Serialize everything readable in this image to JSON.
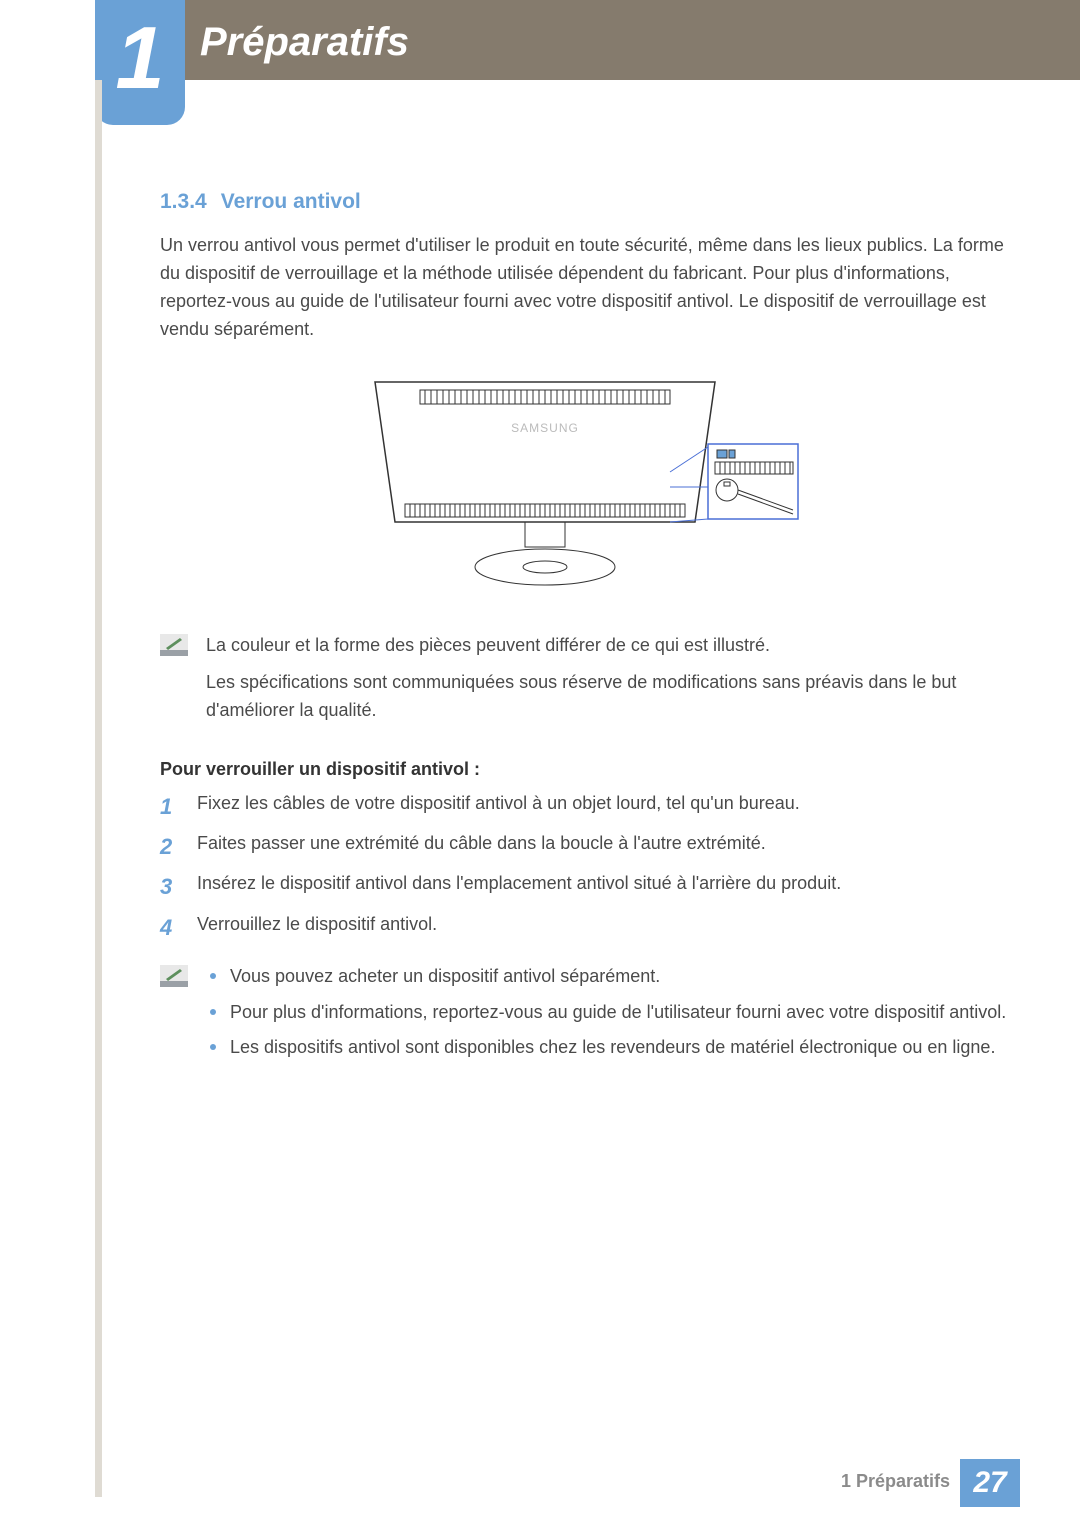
{
  "chapter": {
    "number": "1",
    "title": "Préparatifs"
  },
  "section": {
    "number": "1.3.4",
    "title": "Verrou antivol"
  },
  "intro_paragraph": "Un verrou antivol vous permet d'utiliser le produit en toute sécurité, même dans les lieux publics. La forme du dispositif de verrouillage et la méthode utilisée dépendent du fabricant. Pour plus d'informations, reportez-vous au guide de l'utilisateur fourni avec votre dispositif antivol. Le dispositif de verrouillage est vendu séparément.",
  "figure_brand_text": "SAMSUNG",
  "note1": {
    "line1": "La couleur et la forme des pièces peuvent différer de ce qui est illustré.",
    "line2": "Les spécifications sont communiquées sous réserve de modifications sans préavis dans le but d'améliorer la qualité."
  },
  "procedure": {
    "heading": "Pour verrouiller un dispositif antivol :",
    "steps": [
      "Fixez les câbles de votre dispositif antivol à un objet lourd, tel qu'un bureau.",
      "Faites passer une extrémité du câble dans la boucle à l'autre extrémité.",
      "Insérez le dispositif antivol dans l'emplacement antivol situé à l'arrière du produit.",
      "Verrouillez le dispositif antivol."
    ]
  },
  "note2": {
    "bullets": [
      "Vous pouvez acheter un dispositif antivol séparément.",
      "Pour plus d'informations, reportez-vous au guide de l'utilisateur fourni avec votre dispositif antivol.",
      "Les dispositifs antivol sont disponibles chez les revendeurs de matériel électronique ou en ligne."
    ]
  },
  "footer": {
    "crumb": "1 Préparatifs",
    "page": "27"
  }
}
